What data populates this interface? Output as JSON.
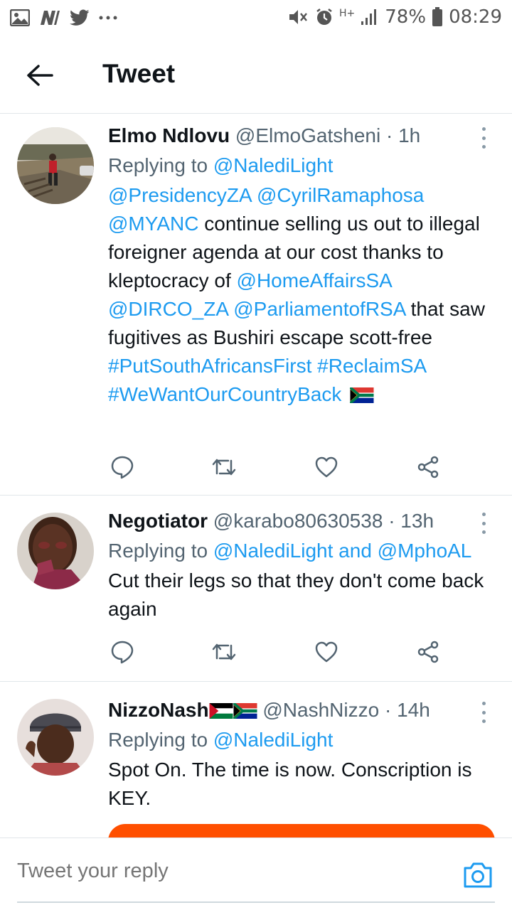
{
  "status_bar": {
    "battery": "78%",
    "time": "08:29",
    "network": "H+",
    "notification_icons": [
      "gallery-icon",
      "news-icon",
      "twitter-icon",
      "more-dots-icon"
    ]
  },
  "header": {
    "title": "Tweet"
  },
  "tweets": [
    {
      "name": "Elmo Ndlovu",
      "handle": "@ElmoGatsheni",
      "sep": "·",
      "time": "1h",
      "replying_prefix": "Replying to",
      "replying_to": "@NalediLight",
      "text_segments": [
        {
          "t": "@PresidencyZA @CyrilRamaphosa @MYANC",
          "link": true
        },
        {
          "t": " continue selling us out to illegal foreigner agenda at our cost thanks to kleptocracy of ",
          "link": false
        },
        {
          "t": "@HomeAffairsSA @DIRCO_ZA @ParliamentofRSA",
          "link": true
        },
        {
          "t": " that saw fugitives as Bushiri escape scott-free ",
          "link": false
        },
        {
          "t": "#PutSouthAfricansFirst #ReclaimSA #WeWantOurCountryBack",
          "link": true
        }
      ]
    },
    {
      "name": "Negotiator",
      "handle": "@karabo80630538",
      "sep": "·",
      "time": "13h",
      "replying_prefix": "Replying to",
      "replying_to": "@NalediLight and @MphoAL",
      "text": "Cut their legs so that they don't come back again"
    },
    {
      "name": "NizzoNash",
      "handle": "@NashNizzo",
      "sep": "·",
      "time": "14h",
      "replying_prefix": "Replying to",
      "replying_to": "@NalediLight",
      "text": "Spot On. The time is now. Conscription is KEY."
    }
  ],
  "reply_bar": {
    "placeholder": "Tweet your reply"
  },
  "colors": {
    "link": "#1d9bf0",
    "text": "#0f1419",
    "secondary": "#536471",
    "divider": "#e1e6ea",
    "media_orange": "#ff4f00"
  }
}
